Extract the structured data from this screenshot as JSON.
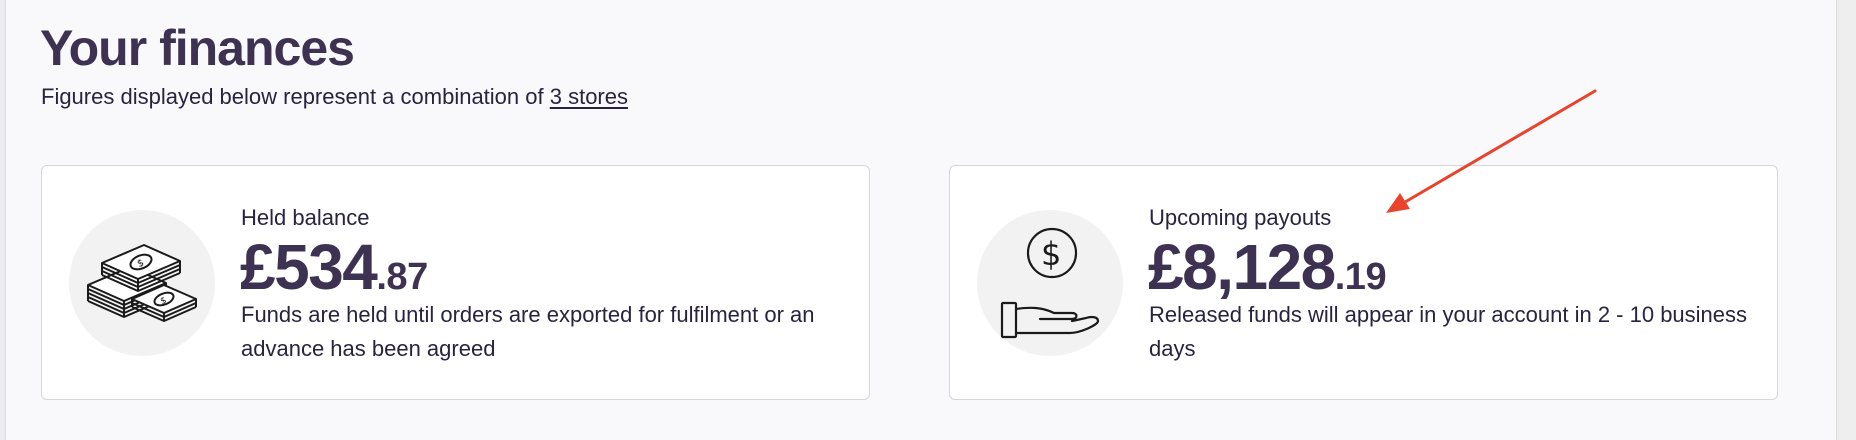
{
  "page": {
    "title": "Your finances",
    "subtitle_prefix": "Figures displayed below represent a combination of ",
    "stores_link": "3 stores"
  },
  "cards": {
    "held": {
      "icon": "cash-stack-icon",
      "label": "Held balance",
      "amount_main": "£534",
      "amount_pence": ".87",
      "description": "Funds are held until orders are exported for fulfilment or an advance has been agreed"
    },
    "upcoming": {
      "icon": "hand-dollar-coin-icon",
      "label": "Upcoming payouts",
      "amount_main": "£8,128",
      "amount_pence": ".19",
      "description": "Released funds will appear in your account in 2 - 10 business days"
    }
  },
  "colors": {
    "heading": "#3d3252",
    "text": "#2a2340",
    "icon_circle": "#f2f2f2",
    "card_border": "#d6d6da",
    "annotation_arrow": "#e8432b"
  }
}
